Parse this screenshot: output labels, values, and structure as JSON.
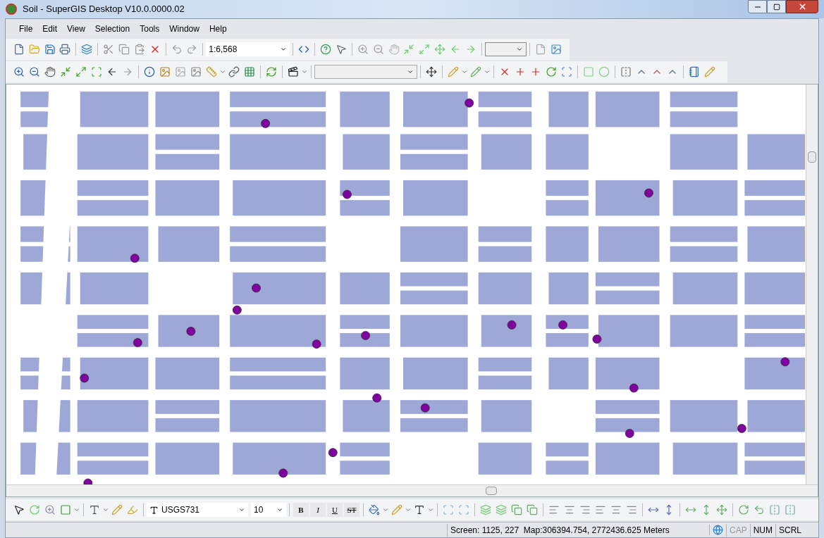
{
  "window": {
    "title": "Soil - SuperGIS Desktop V10.0.0000.02"
  },
  "menu": [
    "File",
    "Edit",
    "View",
    "Selection",
    "Tools",
    "Window",
    "Help"
  ],
  "standard_toolbar": {
    "scale": "1:6,568"
  },
  "text_toolbar": {
    "font": "USGS731",
    "size": "10",
    "styles": [
      {
        "label": "B",
        "kind": "bold"
      },
      {
        "label": "I",
        "kind": "italic"
      },
      {
        "label": "U",
        "kind": "underline"
      },
      {
        "label": "ST",
        "kind": "strike"
      }
    ]
  },
  "status_bar": {
    "coordinates": "Screen: 1125, 227  Map:306394.754, 2772436.625 Meters",
    "indicators": [
      {
        "label": "CAP",
        "on": false
      },
      {
        "label": "NUM",
        "on": true
      },
      {
        "label": "SCRL",
        "on": true
      }
    ]
  }
}
